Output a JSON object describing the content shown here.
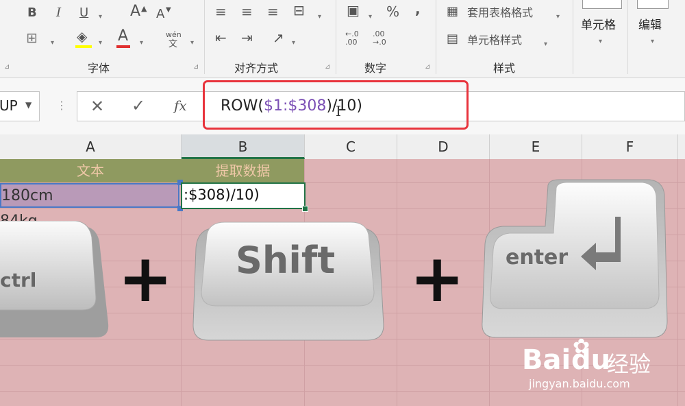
{
  "ribbon": {
    "font_group": "字体",
    "align_group": "对齐方式",
    "number_group": "数字",
    "styles_group": "样式",
    "bold": "B",
    "italic": "I",
    "underline": "U",
    "grow_font": "A",
    "shrink_font": "A",
    "font_color": "A",
    "phonetic": "wén",
    "phonetic_sub": "文",
    "percent": "%",
    "comma": ",",
    "dec_inc": "←.0 .00",
    "dec_dec": ".00 →.0",
    "table_format": "套用表格格式",
    "cell_styles": "单元格样式",
    "cells": "单元格",
    "editing": "编辑"
  },
  "formula_bar": {
    "name_box": "UP",
    "cancel": "✕",
    "enter": "✓",
    "fx": "fx",
    "formula_prefix": "ROW(",
    "formula_ref": "$1:$308",
    "formula_suffix": ")/10)"
  },
  "grid": {
    "columns": [
      "A",
      "B",
      "C",
      "D",
      "E",
      "F"
    ],
    "header_a": "文本",
    "header_b": "提取数据",
    "a2": "180cm",
    "a3": "84kg",
    "b2": ":$308)/10)"
  },
  "keys": {
    "ctrl": "ctrl",
    "shift": "Shift",
    "enter": "enter",
    "plus": "+"
  },
  "watermark": {
    "brand": "Bai",
    "brand2": "du",
    "brand_cn": "经验",
    "url": "jingyan.baidu.com"
  },
  "colors": {
    "sheet_bg": "#deb3b5",
    "header_green": "#8f9a60",
    "highlight": "#e8333c",
    "ref_purple": "#7b4fb5"
  }
}
